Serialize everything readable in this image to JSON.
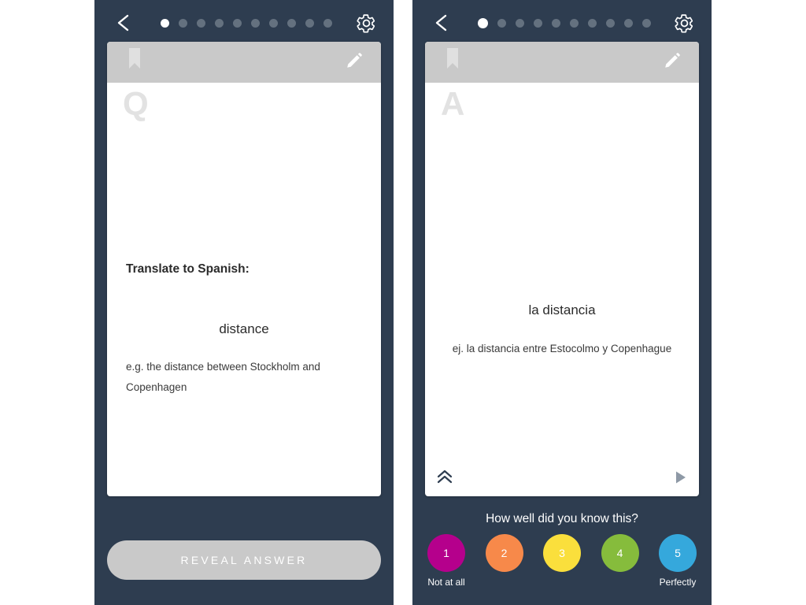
{
  "colors": {
    "app_background": "#2e3d50",
    "card_header": "#c9c9c9",
    "card_body": "#ffffff",
    "dot_inactive": "#64717f",
    "dot_active": "#ffffff",
    "reveal_button": "#c9c9c9"
  },
  "question_panel": {
    "topbar": {
      "back_icon": "chevron-left-icon",
      "settings_icon": "gear-icon",
      "dots_total": 10,
      "dots_active_index": 0
    },
    "card": {
      "bookmark_icon": "bookmark-icon",
      "edit_icon": "pencil-icon",
      "watermark": "Q",
      "prompt": "Translate to Spanish:",
      "term": "distance",
      "example": "e.g. the distance between Stockholm and Copenhagen"
    },
    "reveal_label": "REVEAL ANSWER"
  },
  "answer_panel": {
    "topbar": {
      "back_icon": "chevron-left-icon",
      "settings_icon": "gear-icon",
      "dots_total": 10,
      "dots_active_index": 0
    },
    "card": {
      "bookmark_icon": "bookmark-icon",
      "edit_icon": "pencil-icon",
      "watermark": "A",
      "term": "la distancia",
      "example": "ej. la distancia entre Estocolmo y Copenhague",
      "collapse_icon": "chevron-double-up-icon",
      "audio_icon": "play-icon"
    },
    "rating": {
      "title": "How well did you know this?",
      "options": [
        {
          "value": "1",
          "label": "Not at all",
          "color": "#b5008c"
        },
        {
          "value": "2",
          "label": "",
          "color": "#f7894a"
        },
        {
          "value": "3",
          "label": "",
          "color": "#fadf3c"
        },
        {
          "value": "4",
          "label": "",
          "color": "#86bc3c"
        },
        {
          "value": "5",
          "label": "Perfectly",
          "color": "#35a8dc"
        }
      ]
    }
  }
}
